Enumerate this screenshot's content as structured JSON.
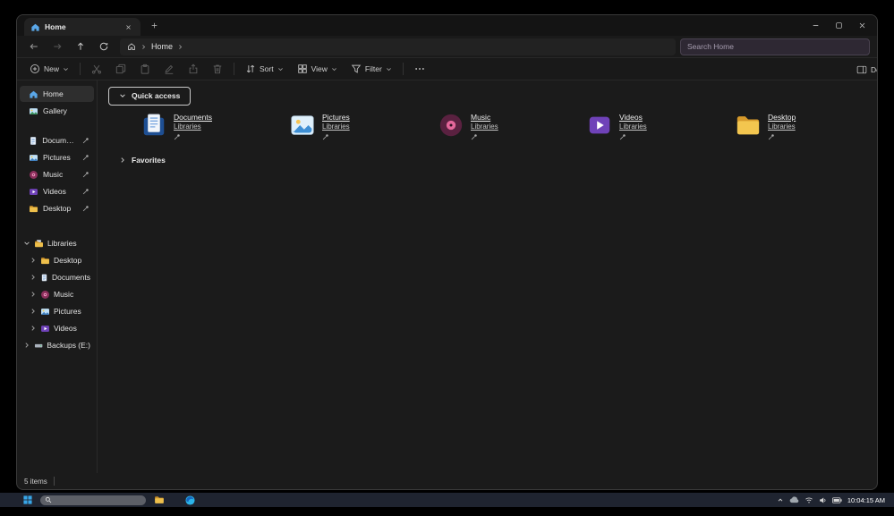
{
  "window": {
    "tab": {
      "title": "Home"
    },
    "nav": {
      "breadcrumb": {
        "root": "Home"
      },
      "search": {
        "placeholder": "Search Home"
      }
    },
    "toolbar": {
      "new_label": "New",
      "sort_label": "Sort",
      "view_label": "View",
      "filter_label": "Filter",
      "details_label": "Details"
    },
    "sidebar": {
      "items": [
        {
          "label": "Home"
        },
        {
          "label": "Gallery"
        }
      ],
      "pinned": [
        {
          "label": "Documents"
        },
        {
          "label": "Pictures"
        },
        {
          "label": "Music"
        },
        {
          "label": "Videos"
        },
        {
          "label": "Desktop"
        }
      ],
      "tree": [
        {
          "label": "Libraries"
        },
        {
          "label": "Desktop"
        },
        {
          "label": "Documents"
        },
        {
          "label": "Music"
        },
        {
          "label": "Pictures"
        },
        {
          "label": "Videos"
        },
        {
          "label": "Backups (E:)"
        }
      ]
    },
    "content": {
      "quick_access_label": "Quick access",
      "favorites_label": "Favorites",
      "tiles": [
        {
          "name": "Documents",
          "location": "Libraries"
        },
        {
          "name": "Pictures",
          "location": "Libraries"
        },
        {
          "name": "Music",
          "location": "Libraries"
        },
        {
          "name": "Videos",
          "location": "Libraries"
        },
        {
          "name": "Desktop",
          "location": "Libraries"
        }
      ]
    },
    "statusbar": {
      "item_count": "5 items"
    }
  },
  "taskbar": {
    "clock": "10:04:15 AM"
  }
}
